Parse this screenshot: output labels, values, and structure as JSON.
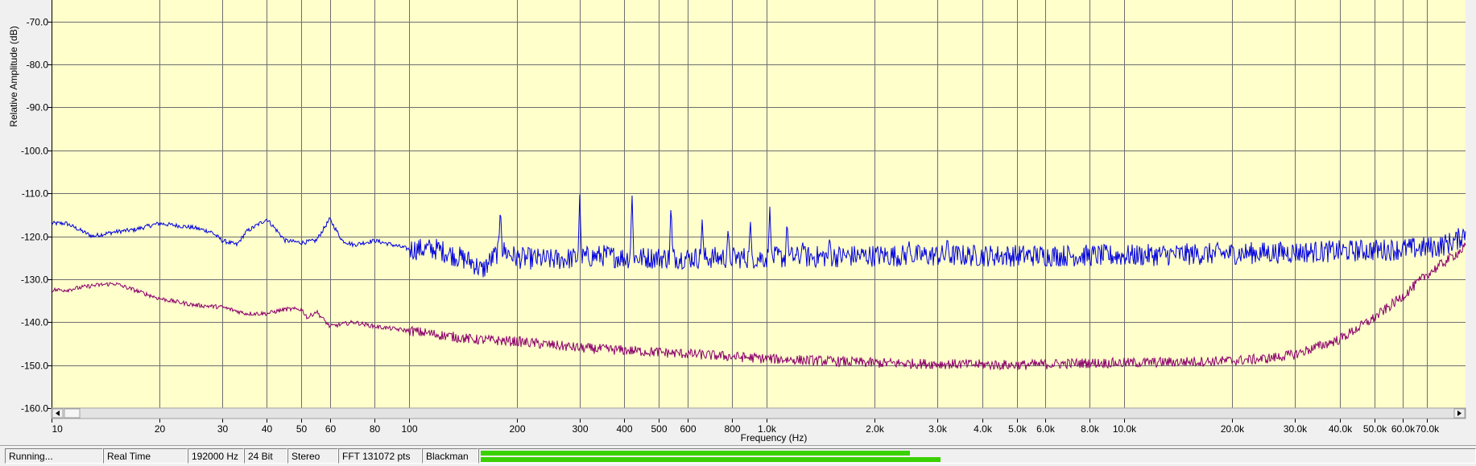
{
  "chart_data": {
    "type": "line",
    "xscale": "log",
    "xlim": [
      10,
      90000
    ],
    "ylim": [
      -160,
      -65
    ],
    "xlabel": "Frequency (Hz)",
    "ylabel": "Relative Amplitude (dB)",
    "grid": true,
    "y_ticks": [
      -70,
      -80,
      -90,
      -100,
      -110,
      -120,
      -130,
      -140,
      -150,
      -160
    ],
    "y_tick_labels": [
      "-70.0",
      "-80.0",
      "-90.0",
      "-100.0",
      "-110.0",
      "-120.0",
      "-130.0",
      "-140.0",
      "-150.0",
      "-160.0"
    ],
    "x_ticks": [
      10,
      20,
      30,
      40,
      50,
      60,
      80,
      100,
      200,
      300,
      400,
      500,
      600,
      800,
      1000,
      2000,
      3000,
      4000,
      5000,
      6000,
      8000,
      10000,
      20000,
      30000,
      40000,
      50000,
      60000,
      70000
    ],
    "x_tick_labels": [
      "10",
      "20",
      "30",
      "40",
      "50",
      "60",
      "80",
      "100",
      "200",
      "300",
      "400",
      "500",
      "600",
      "800",
      "1.0k",
      "2.0k",
      "3.0k",
      "4.0k",
      "5.0k",
      "6.0k",
      "8.0k",
      "10.0k",
      "20.0k",
      "30.0k",
      "40.0k",
      "50.0k",
      "60.0k",
      "70.0k"
    ],
    "series": [
      {
        "color": "#0000e0",
        "x": [
          10,
          11,
          13,
          15,
          17,
          20,
          25,
          28,
          30,
          33,
          35,
          40,
          43,
          45,
          50,
          55,
          60,
          65,
          70,
          80,
          90,
          100,
          120,
          150,
          160,
          180,
          190,
          200,
          250,
          300,
          350,
          400,
          500,
          700,
          1000,
          2000,
          5000,
          10000,
          20000,
          40000,
          60000,
          75000,
          85000,
          90000
        ],
        "y": [
          -117,
          -117,
          -120,
          -119,
          -118.5,
          -117,
          -118,
          -119,
          -121,
          -122,
          -119,
          -116,
          -119,
          -121,
          -121.5,
          -121,
          -116,
          -121,
          -122,
          -121,
          -122,
          -123,
          -123,
          -126,
          -128,
          -123,
          -124,
          -125,
          -125.5,
          -125,
          -124.5,
          -125,
          -125,
          -125,
          -125,
          -124.5,
          -124.5,
          -124.5,
          -124,
          -123.5,
          -123,
          -122.5,
          -121,
          -119
        ],
        "peaks": [
          {
            "x": 180,
            "y": -113
          },
          {
            "x": 300,
            "y": -110
          },
          {
            "x": 420,
            "y": -109.5
          },
          {
            "x": 540,
            "y": -112
          },
          {
            "x": 660,
            "y": -116
          },
          {
            "x": 780,
            "y": -118
          },
          {
            "x": 900,
            "y": -116
          },
          {
            "x": 1020,
            "y": -113
          },
          {
            "x": 1140,
            "y": -116
          },
          {
            "x": 1260,
            "y": -121
          },
          {
            "x": 1500,
            "y": -120
          },
          {
            "x": 2500,
            "y": -121
          },
          {
            "x": 3200,
            "y": -120
          }
        ]
      },
      {
        "color": "#8b006b",
        "x": [
          10,
          11,
          13,
          15,
          17,
          20,
          25,
          30,
          35,
          40,
          45,
          50,
          52,
          55,
          60,
          70,
          80,
          100,
          150,
          200,
          300,
          500,
          1000,
          2000,
          5000,
          8000,
          10000,
          20000,
          25000,
          30000,
          40000,
          50000,
          60000,
          70000,
          85000,
          90000
        ],
        "y": [
          -132.5,
          -132.5,
          -131.5,
          -131,
          -132.5,
          -134.5,
          -136,
          -136.5,
          -138,
          -138,
          -137,
          -137,
          -139,
          -137.5,
          -141,
          -140,
          -141,
          -142,
          -144,
          -144.5,
          -146,
          -147,
          -148.5,
          -149.5,
          -150,
          -149.5,
          -149.5,
          -149,
          -148.5,
          -147.5,
          -144,
          -139,
          -134,
          -129,
          -124,
          -122.5
        ]
      }
    ]
  },
  "statusbar": {
    "state": "Running...",
    "mode": "Real Time",
    "sample_rate": "192000 Hz",
    "bit_depth": "24 Bit",
    "channels": "Stereo",
    "fft": "FFT 131072 pts",
    "window": "Blackman",
    "meter_left_level": 0.85,
    "meter_right_level": 0.91
  },
  "colors": {
    "plot_background": "#ffffcc",
    "grid": "#6e6e6e",
    "meter": "#39d100"
  },
  "icons": {
    "scroll_left": "triangle-left-icon",
    "scroll_right": "triangle-right-icon"
  }
}
